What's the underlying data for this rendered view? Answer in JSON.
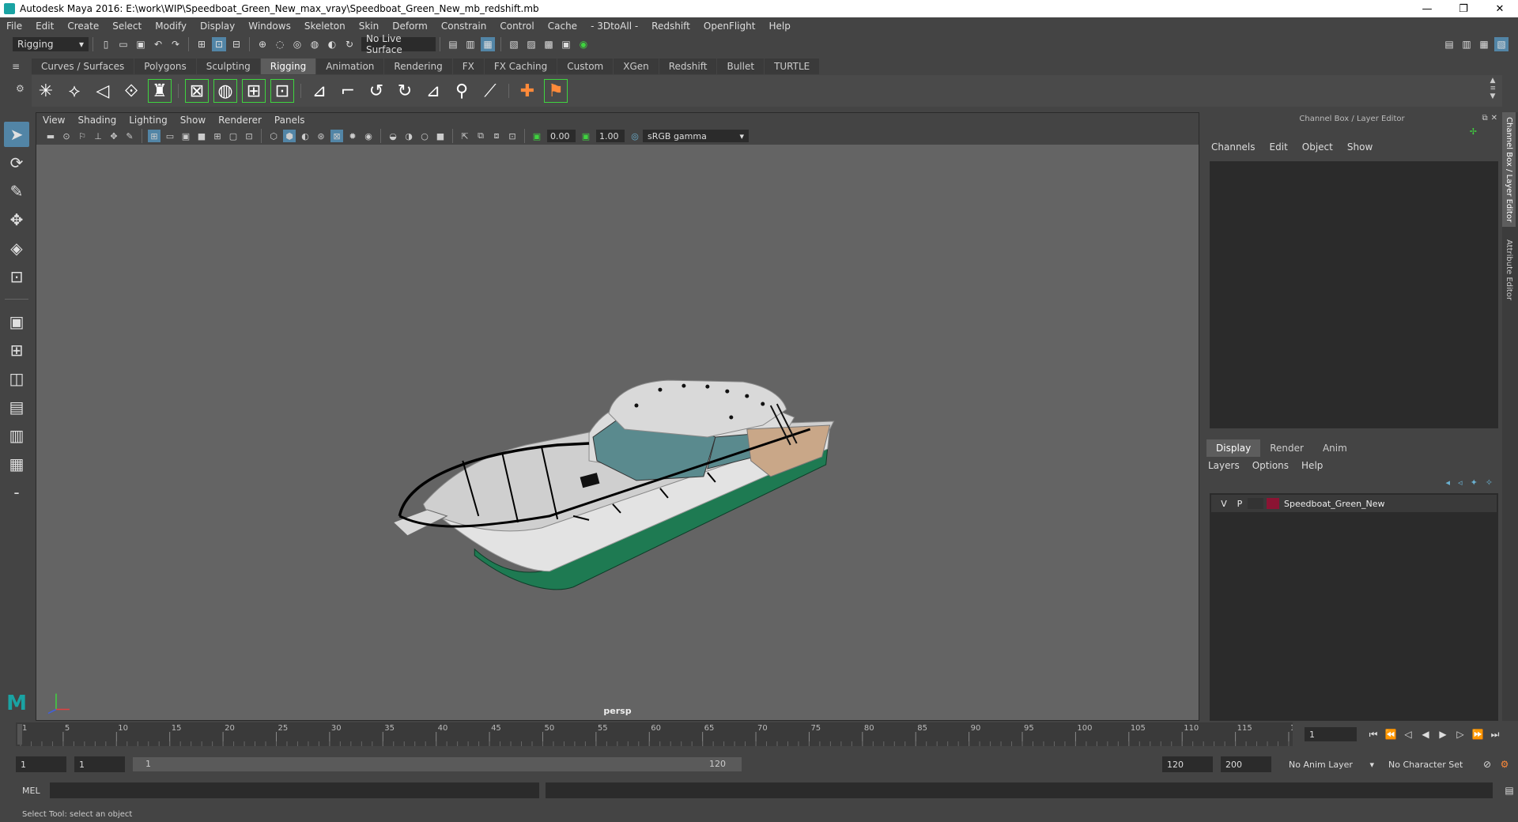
{
  "window": {
    "title": "Autodesk Maya 2016: E:\\work\\WIP\\Speedboat_Green_New_max_vray\\Speedboat_Green_New_mb_redshift.mb",
    "minimize": "—",
    "restore": "❐",
    "close": "✕"
  },
  "menubar": [
    "File",
    "Edit",
    "Create",
    "Select",
    "Modify",
    "Display",
    "Windows",
    "Skeleton",
    "Skin",
    "Deform",
    "Constrain",
    "Control",
    "Cache",
    "- 3DtoAll -",
    "Redshift",
    "OpenFlight",
    "Help"
  ],
  "statusline": {
    "mode_selected": "Rigging",
    "live_surface": "No Live Surface"
  },
  "shelf_tabs": [
    "Curves / Surfaces",
    "Polygons",
    "Sculpting",
    "Rigging",
    "Animation",
    "Rendering",
    "FX",
    "FX Caching",
    "Custom",
    "XGen",
    "Redshift",
    "Bullet",
    "TURTLE"
  ],
  "shelf_active": "Rigging",
  "viewport": {
    "menu": [
      "View",
      "Shading",
      "Lighting",
      "Show",
      "Renderer",
      "Panels"
    ],
    "exposure": "0.00",
    "gamma": "1.00",
    "color_space": "sRGB gamma",
    "camera_label": "persp"
  },
  "channel_box": {
    "title": "Channel Box / Layer Editor",
    "menu": [
      "Channels",
      "Edit",
      "Object",
      "Show"
    ]
  },
  "layer_editor": {
    "tabs": [
      "Display",
      "Render",
      "Anim"
    ],
    "active_tab": "Display",
    "menu": [
      "Layers",
      "Options",
      "Help"
    ],
    "layers": [
      {
        "v": "V",
        "p": "P",
        "name": "Speedboat_Green_New",
        "color": "#8b1433"
      }
    ]
  },
  "side_tabs": [
    "Channel Box / Layer Editor",
    "Attribute Editor"
  ],
  "timeline": {
    "ticks": [
      "1",
      "5",
      "10",
      "15",
      "20",
      "25",
      "30",
      "35",
      "40",
      "45",
      "50",
      "55",
      "60",
      "65",
      "70",
      "75",
      "80",
      "85",
      "90",
      "95",
      "100",
      "105",
      "110",
      "115",
      "120"
    ],
    "current_frame": "1"
  },
  "range": {
    "start": "1",
    "playback_start": "1",
    "slider_start": "1",
    "slider_end": "120",
    "playback_end": "120",
    "end": "200",
    "anim_layer": "No Anim Layer",
    "character_set": "No Character Set"
  },
  "mel": {
    "label": "MEL"
  },
  "help_line": "Select Tool: select an object",
  "colors": {
    "hull_green": "#1e7a52",
    "hull_white": "#e6e6e6",
    "glass": "#5a8a8e",
    "accent_active": "#5285a6"
  }
}
